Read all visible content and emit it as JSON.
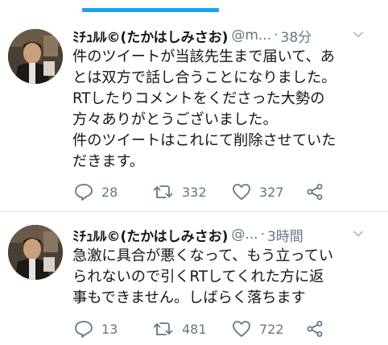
{
  "tweets": [
    {
      "display_name": "ﾐﾁｭﾙﾙ©(たかはしみさお)",
      "handle": "@m...",
      "separator": "·",
      "time": "38分",
      "body_lines": [
        "件のツイートが当該先生まで届いて、あ",
        "とは双方で話し合うことになりました。",
        "RTしたりコメントをくださった大勢の",
        "方々ありがとうございました。",
        "件のツイートはこれにて削除させていた",
        "だきます。"
      ],
      "counts": {
        "replies": "28",
        "retweets": "332",
        "likes": "327"
      }
    },
    {
      "display_name": "ﾐﾁｭﾙﾙ©(たかはしみさお)",
      "handle": "@...",
      "separator": "·",
      "time": "3時間",
      "body_lines": [
        "急激に具合が悪くなって、もう立ってい",
        "られないので引くRTしてくれた方に返",
        "事もできません。しばらく落ちます"
      ],
      "counts": {
        "replies": "13",
        "retweets": "481",
        "likes": "722"
      }
    }
  ],
  "icons": {
    "reply": "reply-icon",
    "retweet": "retweet-icon",
    "like": "heart-icon",
    "share": "share-icon",
    "caret": "chevron-down-icon"
  },
  "colors": {
    "accent": "#1da1f2",
    "text": "#14171a",
    "secondary": "#657786",
    "divider": "#e1e8ed"
  }
}
